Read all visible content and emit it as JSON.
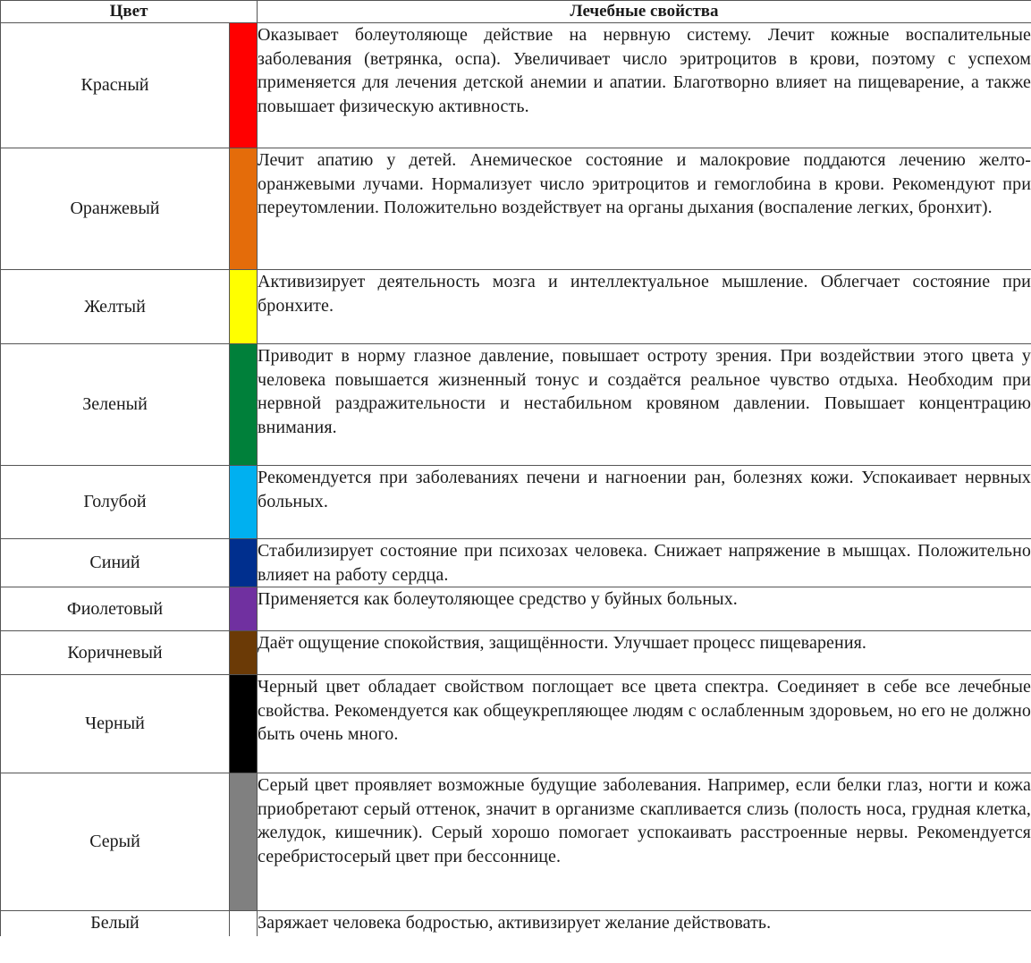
{
  "table": {
    "headers": {
      "color": "Цвет",
      "properties": "Лечебные свойства"
    },
    "rows": [
      {
        "name": "Красный",
        "swatch": "#ff0000",
        "description": "Оказывает болеутоляюще действие на нервную систему. Лечит кожные воспалительные заболевания (ветрянка, оспа). Увеличивает число эритроцитов в крови, поэтому с успехом применяется для лечения детской анемии и апатии. Благотворно влияет на пищеварение, а также повышает физическую активность."
      },
      {
        "name": "Оранжевый",
        "swatch": "#e46c0a",
        "description": "Лечит апатию у детей. Анемическое состояние и малокровие поддаются лечению желто-оранжевыми лучами. Нормализует число эритроцитов и гемоглобина в крови. Рекомендуют при переутомлении. Положительно воздействует на органы дыхания (воспаление легких, бронхит)."
      },
      {
        "name": "Желтый",
        "swatch": "#ffff00",
        "description": "Активизирует деятельность мозга и интеллектуальное мышление. Облегчает состояние при бронхите."
      },
      {
        "name": "Зеленый",
        "swatch": "#00803a",
        "description": "Приводит в норму глазное давление, повышает остроту зрения. При воздействии этого цвета у человека повышается жизненный тонус и создаётся реальное чувство отдыха. Необходим при нервной раздражительности и нестабильном кровяном давлении. Повышает концентрацию внимания."
      },
      {
        "name": "Голубой",
        "swatch": "#00b0f0",
        "description": "Рекомендуется при заболеваниях печени и нагноении ран, болезнях кожи. Успокаивает нервных больных."
      },
      {
        "name": "Синий",
        "swatch": "#002f8e",
        "description": "Стабилизирует состояние при психозах человека. Снижает напряжение в мышцах. Положительно влияет на работу сердца."
      },
      {
        "name": "Фиолетовый",
        "swatch": "#7030a0",
        "description": "Применяется как болеутоляющее средство у буйных больных."
      },
      {
        "name": "Коричневый",
        "swatch": "#6b3a06",
        "description": "Даёт ощущение спокойствия, защищённости. Улучшает процесс пищеварения."
      },
      {
        "name": "Черный",
        "swatch": "#000000",
        "description": "Черный цвет обладает свойством поглощает все цвета спектра. Соединяет в себе все лечебные свойства. Рекомендуется как общеукрепляющее людям с ослабленным здоровьем, но его не должно быть очень много."
      },
      {
        "name": "Серый",
        "swatch": "#808080",
        "description": "Серый цвет проявляет возможные будущие заболевания. Например, если белки глаз, ногти и кожа приобретают серый оттенок, значит в организме скапливается слизь (полость носа, грудная клетка, желудок, кишечник). Серый хорошо помогает успокаивать расстроенные нервы. Рекомендуется серебристосерый цвет при бессоннице."
      },
      {
        "name": "Белый",
        "swatch": "#ffffff",
        "description": "Заряжает человека бодростью, активизирует желание действовать."
      }
    ]
  }
}
